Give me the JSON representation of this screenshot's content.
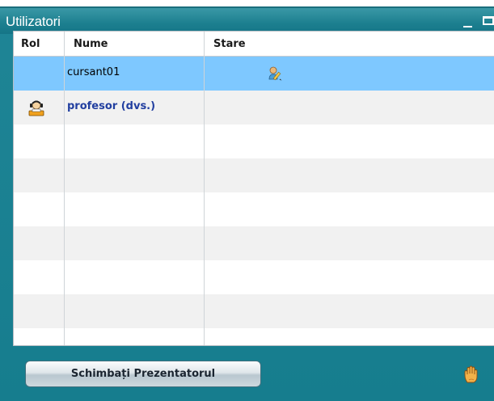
{
  "window": {
    "title": "Utilizatori"
  },
  "table": {
    "columns": [
      "Rol",
      "Nume",
      "Stare"
    ],
    "rows": [
      {
        "role_icon": "",
        "name": "cursant01",
        "status_icon": "pencil-user-icon",
        "selected": true
      },
      {
        "role_icon": "presenter-icon",
        "name": "profesor (dvs.)",
        "status_icon": "",
        "selected": false
      }
    ]
  },
  "footer": {
    "change_presenter_label": "Schimbați Prezentatorul",
    "raise_hand_icon": "raise-hand-icon"
  },
  "colors": {
    "panel": "#1a8190",
    "selected_row": "#7ec8ff",
    "current_user_name": "#223fa0"
  }
}
